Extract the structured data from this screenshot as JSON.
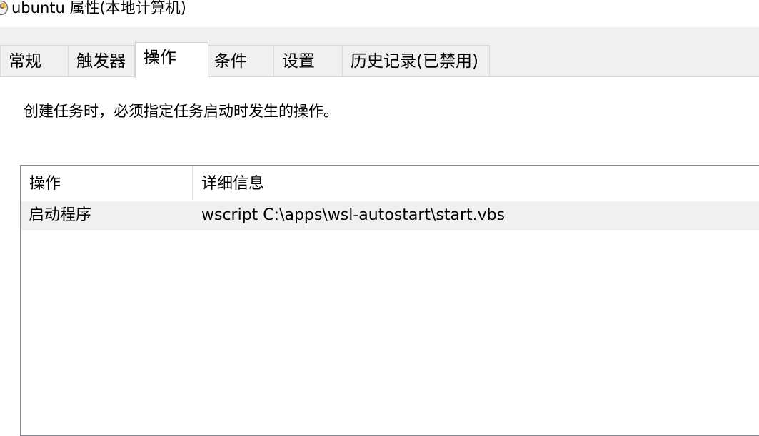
{
  "window": {
    "title": "ubuntu 属性(本地计算机)",
    "icon": "task-scheduler-clock-icon"
  },
  "tabs": [
    {
      "label": "常规",
      "active": false
    },
    {
      "label": "触发器",
      "active": false
    },
    {
      "label": "操作",
      "active": true
    },
    {
      "label": "条件",
      "active": false
    },
    {
      "label": "设置",
      "active": false
    },
    {
      "label": "历史记录(已禁用)",
      "active": false
    }
  ],
  "actions_page": {
    "description": "创建任务时，必须指定任务启动时发生的操作。",
    "columns": [
      "操作",
      "详细信息"
    ],
    "rows": [
      {
        "action": "启动程序",
        "details": "wscript C:\\apps\\wsl-autostart\\start.vbs"
      }
    ]
  },
  "colors": {
    "tab_background": "#f0f0f0",
    "selected_row": "#f0f0f0",
    "list_border": "#828790"
  }
}
